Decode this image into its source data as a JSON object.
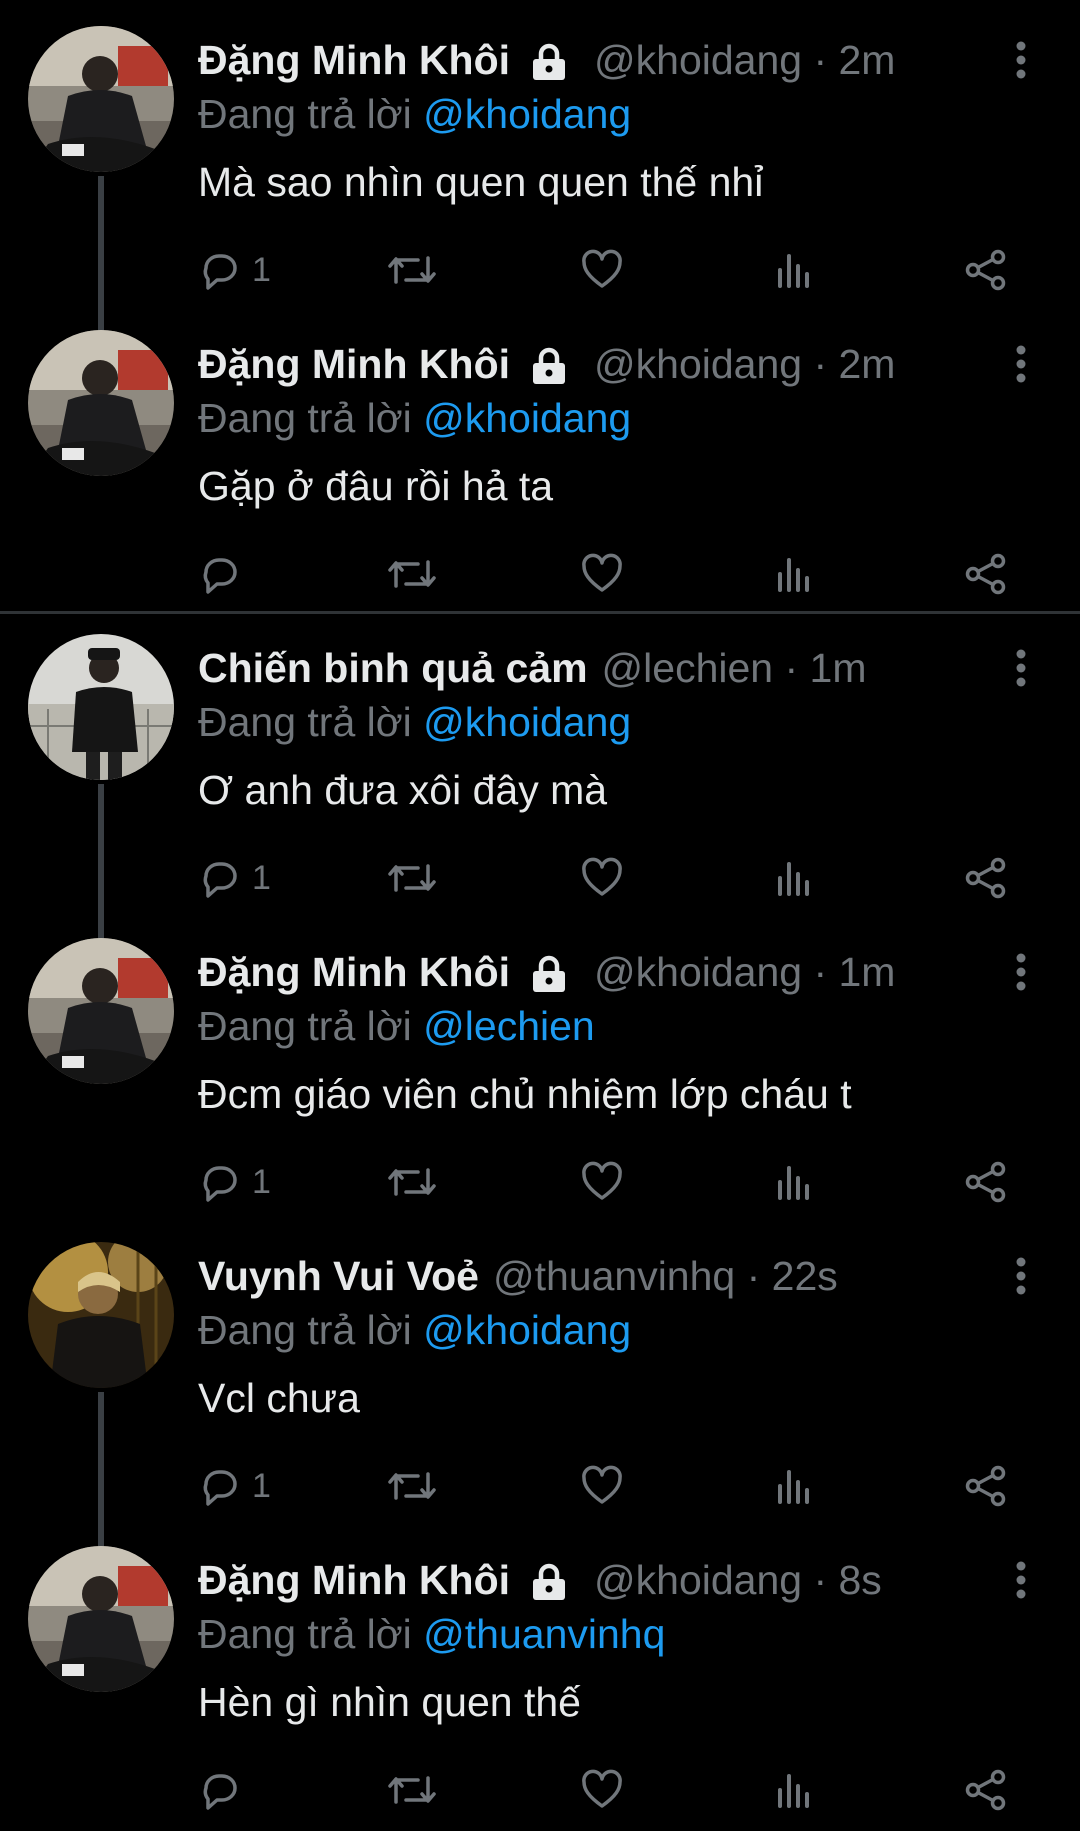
{
  "tweets": [
    {
      "name": "Đặng Minh Khôi",
      "locked": true,
      "handle_time": "@khoidang · 2m",
      "reply_prefix": "Đang trả lời",
      "reply_mention": "@khoidang",
      "text": "Mà sao nhìn quen quen thế nhỉ",
      "reply_count": "1",
      "avatar": "khoidang-avatar"
    },
    {
      "name": "Đặng Minh Khôi",
      "locked": true,
      "handle_time": "@khoidang · 2m",
      "reply_prefix": "Đang trả lời",
      "reply_mention": "@khoidang",
      "text": "Gặp ở đâu rồi hả ta",
      "reply_count": "",
      "avatar": "khoidang-avatar"
    },
    {
      "name": "Chiến binh quả cảm",
      "locked": false,
      "handle_time": "@lechien · 1m",
      "reply_prefix": "Đang trả lời",
      "reply_mention": "@khoidang",
      "text": "Ơ anh đưa xôi đây mà",
      "reply_count": "1",
      "avatar": "lechien-avatar"
    },
    {
      "name": "Đặng Minh Khôi",
      "locked": true,
      "handle_time": "@khoidang · 1m",
      "reply_prefix": "Đang trả lời",
      "reply_mention": "@lechien",
      "text": "Đcm giáo viên chủ nhiệm lớp cháu t",
      "reply_count": "1",
      "avatar": "khoidang-avatar"
    },
    {
      "name": "Vuynh Vui Voẻ",
      "locked": false,
      "handle_time": "@thuanvinhq · 22s",
      "reply_prefix": "Đang trả lời",
      "reply_mention": "@khoidang",
      "text": "Vcl chưa",
      "reply_count": "1",
      "avatar": "thuanvinhq-avatar"
    },
    {
      "name": "Đặng Minh Khôi",
      "locked": true,
      "handle_time": "@khoidang · 8s",
      "reply_prefix": "Đang trả lời",
      "reply_mention": "@thuanvinhq",
      "text": "Hèn gì nhìn quen thế",
      "reply_count": "",
      "avatar": "khoidang-avatar"
    }
  ],
  "icons": {
    "reply": "reply-icon",
    "retweet": "retweet-icon",
    "like": "heart-icon",
    "views": "views-icon",
    "share": "share-icon",
    "more": "more-vertical-icon",
    "lock": "lock-icon"
  },
  "colors": {
    "background": "#000000",
    "text": "#e7e9ea",
    "muted": "#71767b",
    "mention": "#1d9bf0",
    "thread_line": "#3a3f44",
    "divider": "#2f3336"
  }
}
